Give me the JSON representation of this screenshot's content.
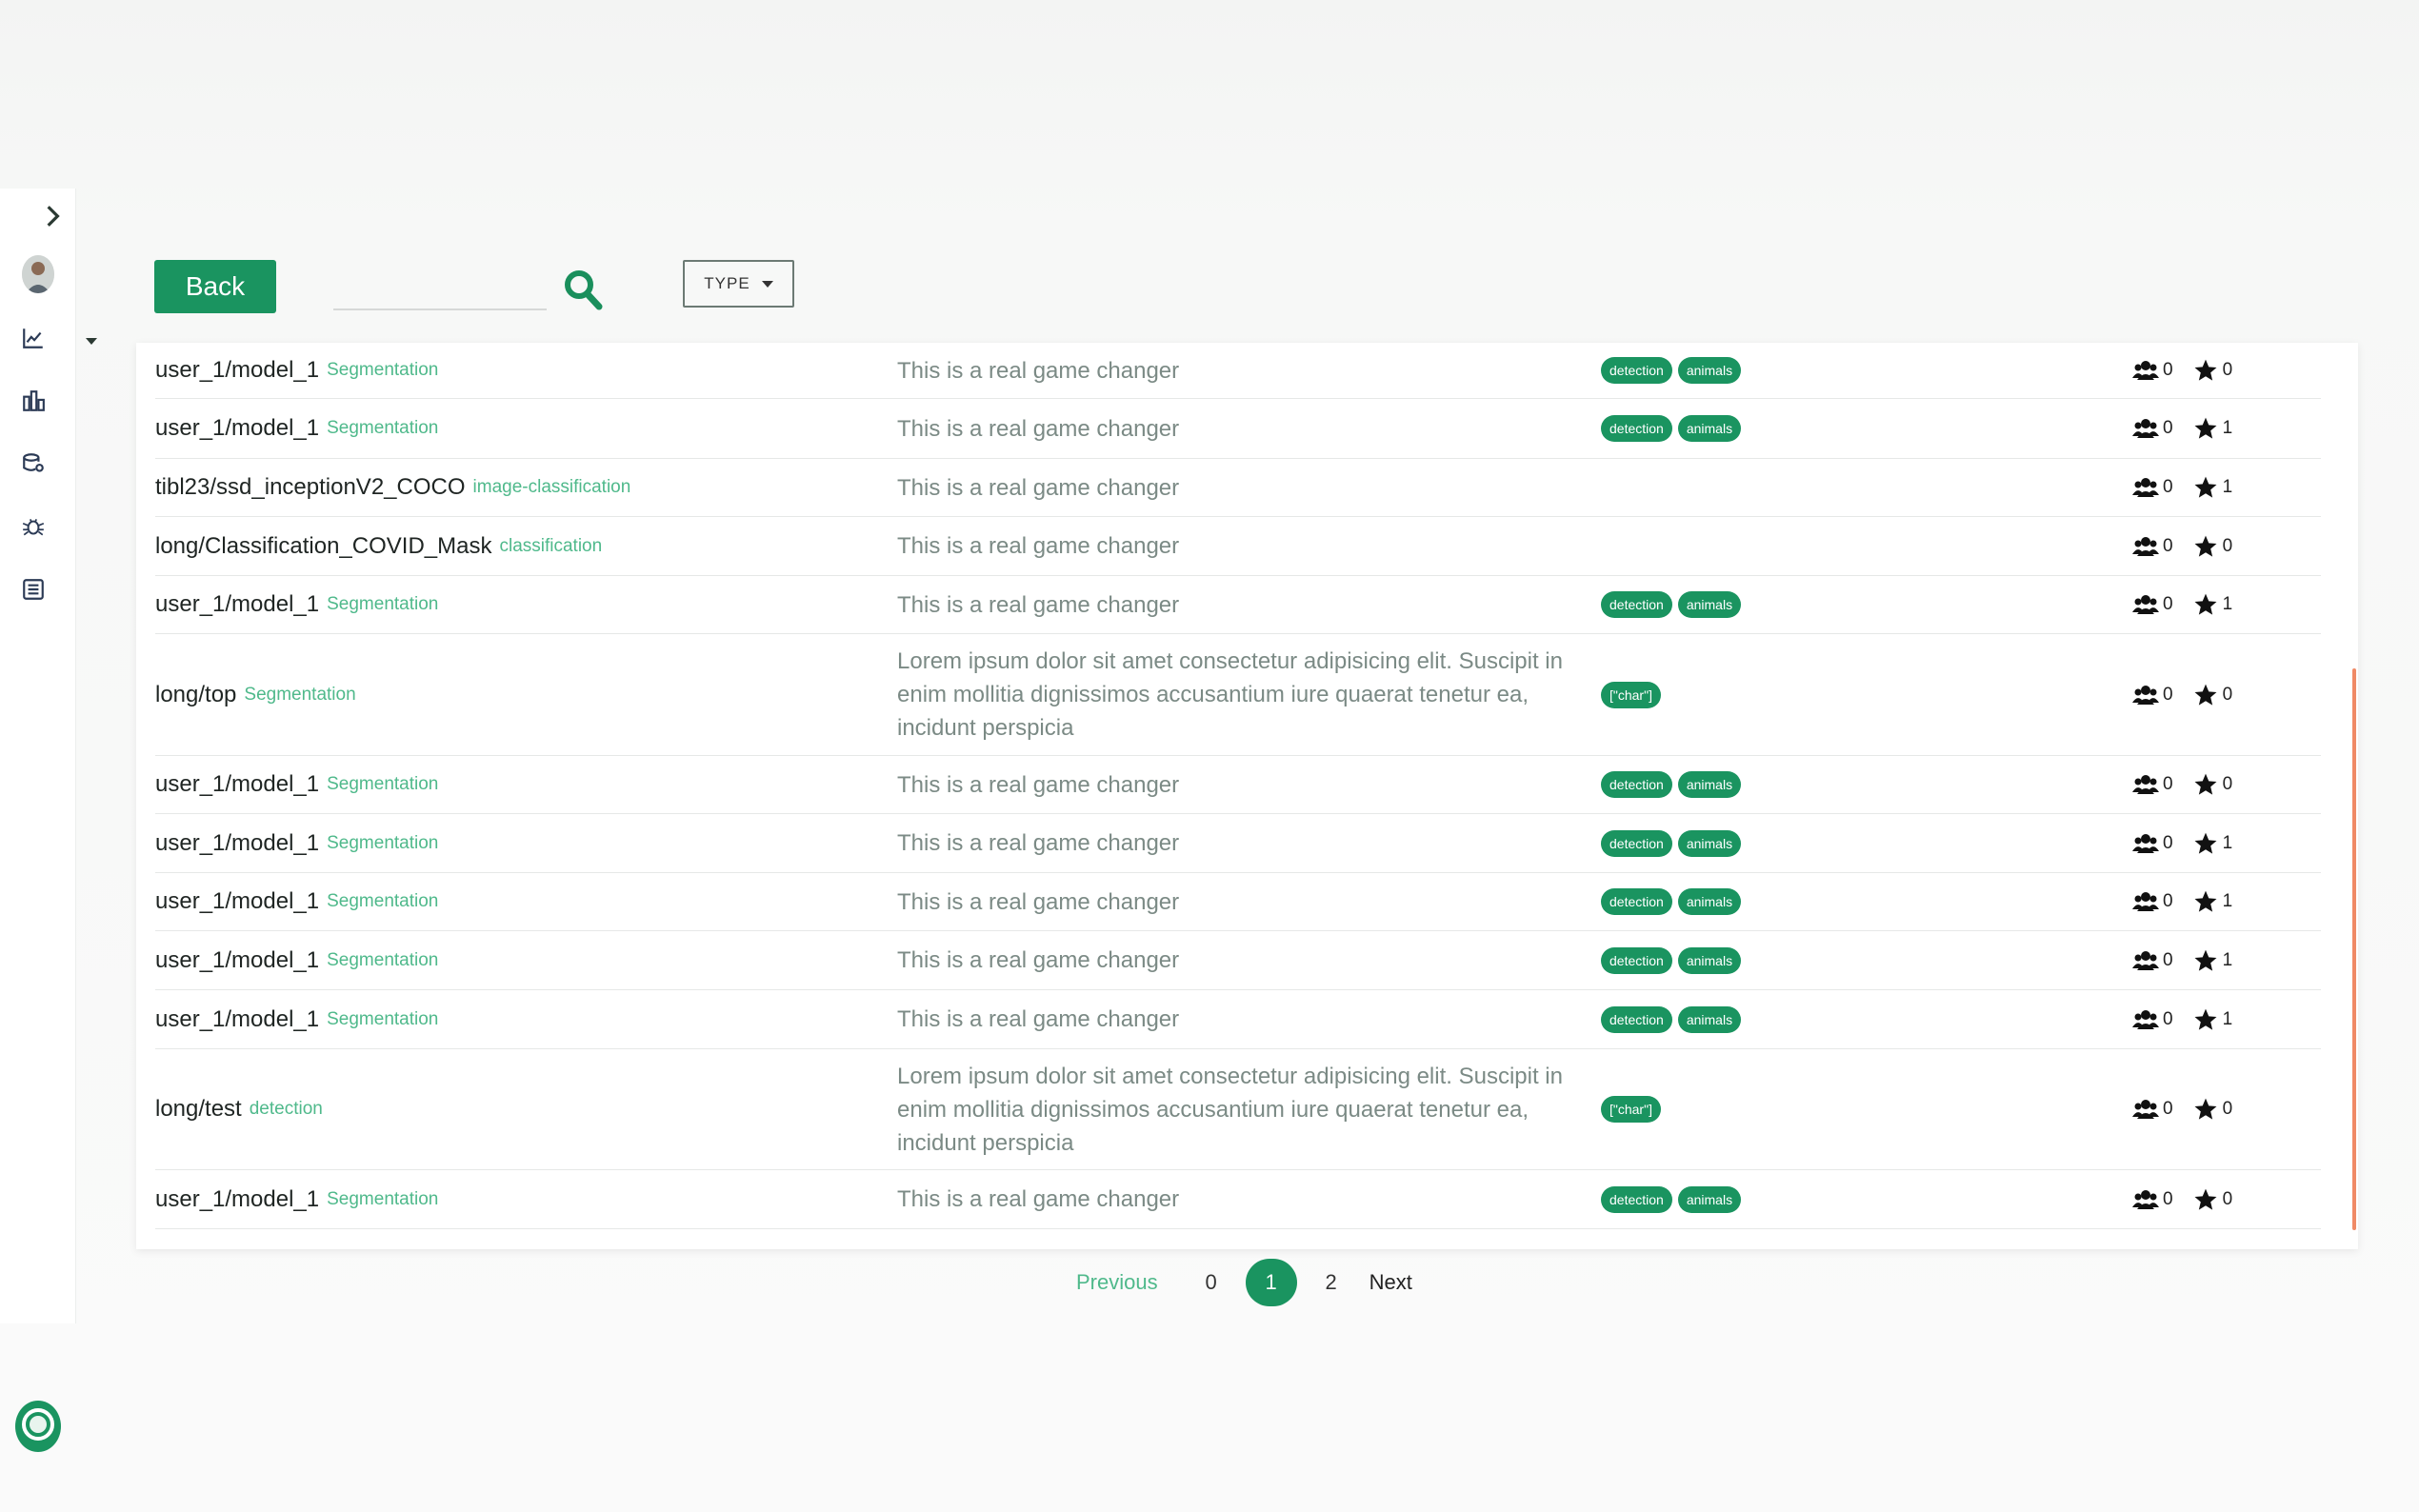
{
  "toolbar": {
    "back_label": "Back",
    "search_value": "",
    "type_label": "TYPE"
  },
  "sidebar": {
    "items": [
      {
        "icon": "chevron-right-icon"
      },
      {
        "icon": "avatar"
      },
      {
        "icon": "chart-line-icon"
      },
      {
        "icon": "bar-chart-icon"
      },
      {
        "icon": "database-gear-icon"
      },
      {
        "icon": "bug-icon"
      },
      {
        "icon": "list-icon"
      }
    ]
  },
  "rows": [
    {
      "name": "user_1/model_1",
      "type": "Segmentation",
      "desc": "This is a real game changer",
      "tags": [
        "detection",
        "animals"
      ],
      "users": "0",
      "stars": "0"
    },
    {
      "name": "user_1/model_1",
      "type": "Segmentation",
      "desc": "This is a real game changer",
      "tags": [
        "detection",
        "animals"
      ],
      "users": "0",
      "stars": "1"
    },
    {
      "name": "tibl23/ssd_inceptionV2_COCO",
      "type": "image-classification",
      "desc": "This is a real game changer",
      "tags": [],
      "users": "0",
      "stars": "1"
    },
    {
      "name": "long/Classification_COVID_Mask",
      "type": "classification",
      "desc": "This is a real game changer",
      "tags": [],
      "users": "0",
      "stars": "0"
    },
    {
      "name": "user_1/model_1",
      "type": "Segmentation",
      "desc": "This is a real game changer",
      "tags": [
        "detection",
        "animals"
      ],
      "users": "0",
      "stars": "1"
    },
    {
      "name": "long/top",
      "type": "Segmentation",
      "desc": "Lorem ipsum dolor sit amet consectetur adipisicing elit. Suscipit in enim mollitia dignissimos accusantium iure quaerat tenetur ea, incidunt perspicia",
      "tags": [
        "[\"char\"]"
      ],
      "users": "0",
      "stars": "0"
    },
    {
      "name": "user_1/model_1",
      "type": "Segmentation",
      "desc": "This is a real game changer",
      "tags": [
        "detection",
        "animals"
      ],
      "users": "0",
      "stars": "0"
    },
    {
      "name": "user_1/model_1",
      "type": "Segmentation",
      "desc": "This is a real game changer",
      "tags": [
        "detection",
        "animals"
      ],
      "users": "0",
      "stars": "1"
    },
    {
      "name": "user_1/model_1",
      "type": "Segmentation",
      "desc": "This is a real game changer",
      "tags": [
        "detection",
        "animals"
      ],
      "users": "0",
      "stars": "1"
    },
    {
      "name": "user_1/model_1",
      "type": "Segmentation",
      "desc": "This is a real game changer",
      "tags": [
        "detection",
        "animals"
      ],
      "users": "0",
      "stars": "1"
    },
    {
      "name": "user_1/model_1",
      "type": "Segmentation",
      "desc": "This is a real game changer",
      "tags": [
        "detection",
        "animals"
      ],
      "users": "0",
      "stars": "1"
    },
    {
      "name": "long/test",
      "type": "detection",
      "desc": "Lorem ipsum dolor sit amet consectetur adipisicing elit. Suscipit in enim mollitia dignissimos accusantium iure quaerat tenetur ea, incidunt perspicia",
      "tags": [
        "[\"char\"]"
      ],
      "users": "0",
      "stars": "0"
    },
    {
      "name": "user_1/model_1",
      "type": "Segmentation",
      "desc": "This is a real game changer",
      "tags": [
        "detection",
        "animals"
      ],
      "users": "0",
      "stars": "0"
    }
  ],
  "pagination": {
    "previous_label": "Previous",
    "pages": [
      "0",
      "1",
      "2"
    ],
    "active_page": "1",
    "next_label": "Next"
  },
  "colors": {
    "accent": "#1a9460",
    "type_text": "#4fb98b",
    "scrollbar": "#f08a66"
  }
}
